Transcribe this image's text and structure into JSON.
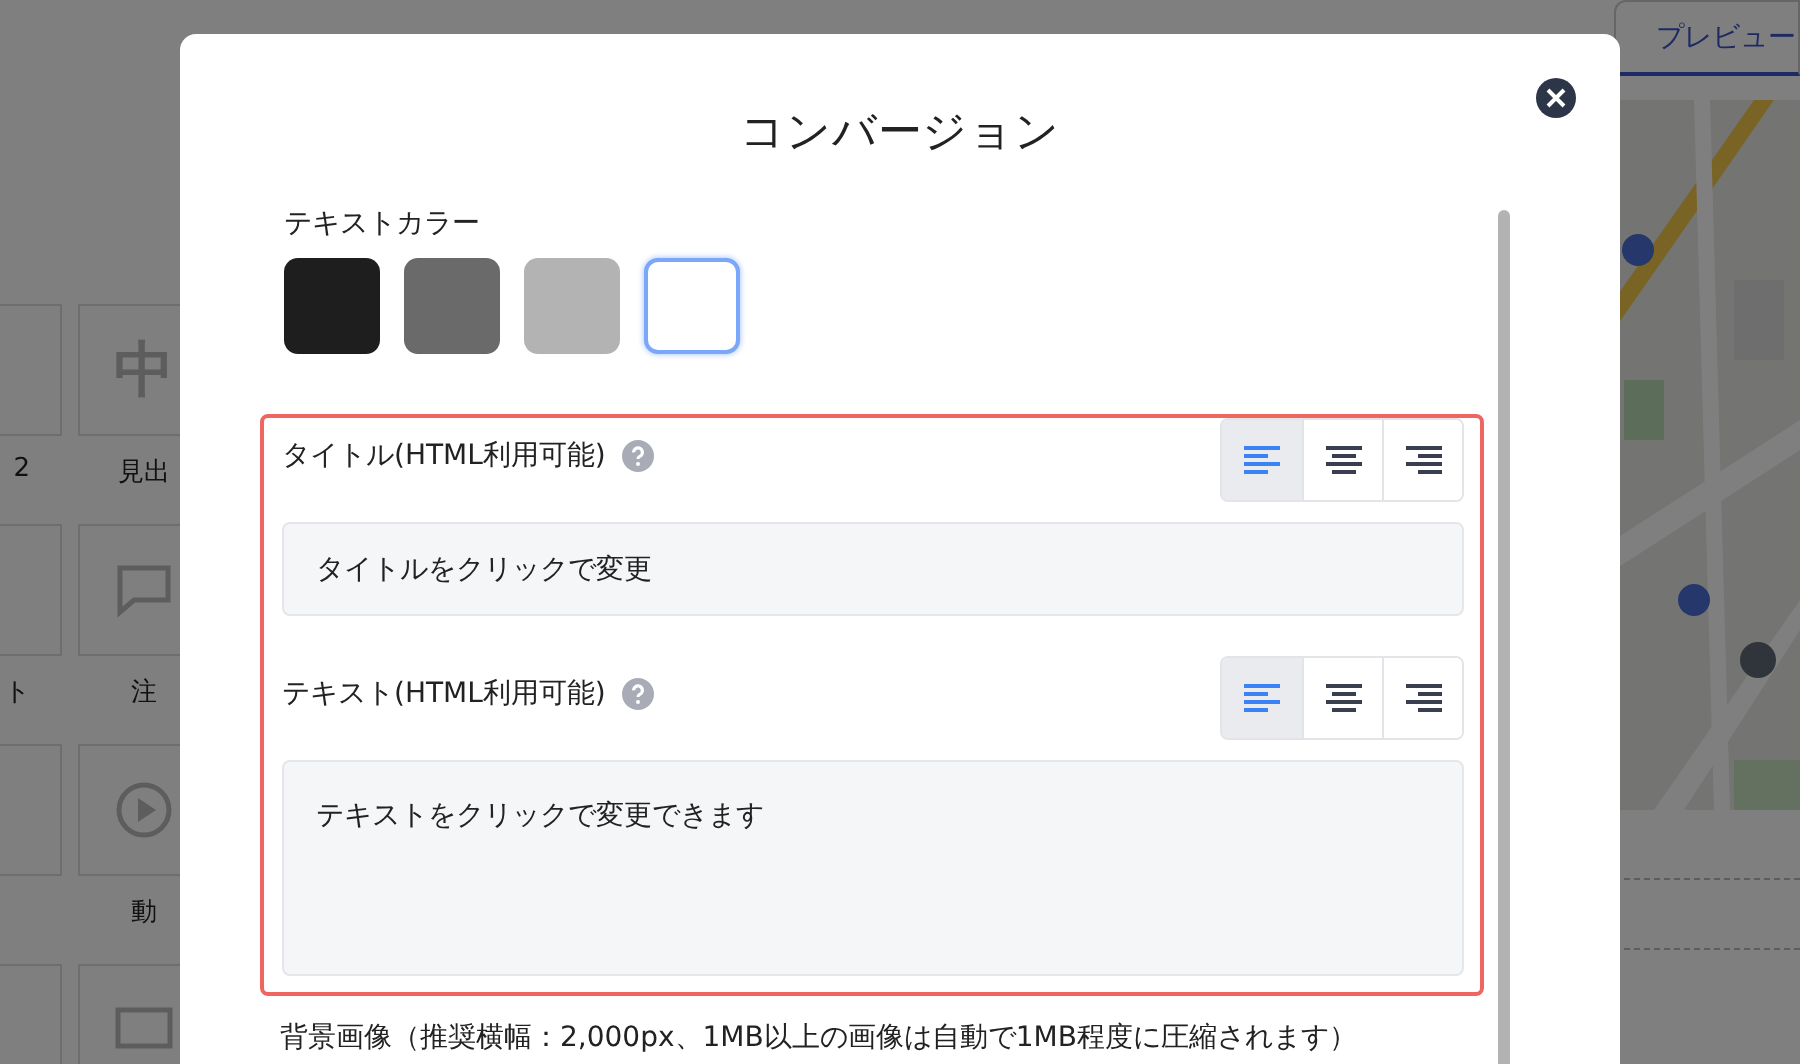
{
  "background": {
    "tile_rows": [
      {
        "tiles": [
          {
            "kind": "blank",
            "label": "2"
          },
          {
            "kind": "glyph",
            "glyph": "中",
            "label": "見出"
          }
        ]
      },
      {
        "tiles": [
          {
            "kind": "blank",
            "label": "ト"
          },
          {
            "kind": "bubble",
            "label": "注"
          }
        ]
      },
      {
        "tiles": [
          {
            "kind": "blank"
          },
          {
            "kind": "play",
            "label": "動"
          }
        ]
      },
      {
        "tiles": [
          {
            "kind": "blank"
          },
          {
            "kind": "card"
          }
        ]
      }
    ],
    "preview_tab": {
      "label": "プレビュー"
    }
  },
  "dialog": {
    "title": "コンバージョン",
    "text_color": {
      "label": "テキストカラー",
      "swatches": [
        {
          "color": "#1e1e1e",
          "selected": false
        },
        {
          "color": "#6a6a6a",
          "selected": false
        },
        {
          "color": "#b3b3b3",
          "selected": false
        },
        {
          "color": "#ffffff",
          "selected": true
        }
      ]
    },
    "fields": [
      {
        "label": "タイトル(HTML利用可能)",
        "kind": "input",
        "value": "タイトルをクリックで変更",
        "align": [
          {
            "kind": "left",
            "selected": true
          },
          {
            "kind": "center",
            "selected": false
          },
          {
            "kind": "right",
            "selected": false
          }
        ]
      },
      {
        "label": "テキスト(HTML利用可能)",
        "kind": "textarea",
        "value": "テキストをクリックで変更できます",
        "align": [
          {
            "kind": "left",
            "selected": true
          },
          {
            "kind": "center",
            "selected": false
          },
          {
            "kind": "right",
            "selected": false
          }
        ]
      }
    ],
    "background_image_label": "背景画像（推奨横幅：2,000px、1MB以上の画像は自動で1MB程度に圧縮されます）"
  }
}
